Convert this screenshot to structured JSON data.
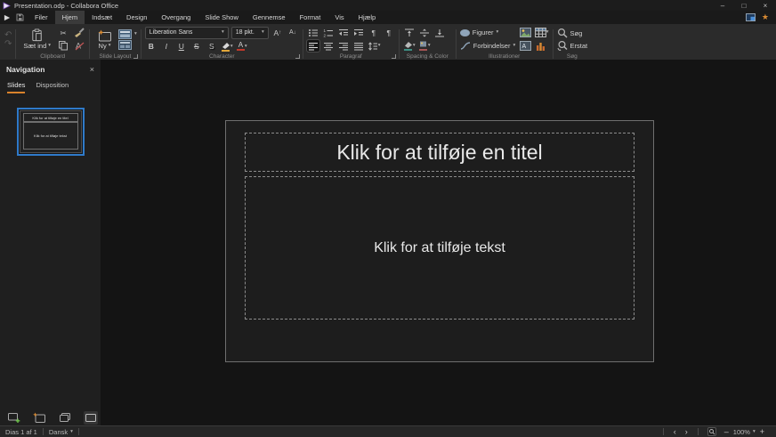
{
  "icons": {
    "dropdown": "▾",
    "minimize": "–",
    "maximize": "□",
    "close": "×",
    "undo": "↶",
    "redo": "↷",
    "cut": "✂",
    "pilcrow": "¶",
    "star": "★",
    "prev": "‹",
    "next": "›",
    "minus": "–",
    "plus": "+",
    "bold": "B",
    "italic": "I",
    "underline": "U",
    "strikethrough": "S",
    "shadow": "S",
    "font_color": "A",
    "grow_font": "A",
    "shrink_font": "A",
    "clear_format": "A",
    "up": "↑",
    "down": "↓",
    "panel_close": "×"
  },
  "titlebar": {
    "title": "Presentation.odp - Collabora Office"
  },
  "menubar": {
    "items": [
      "Filer",
      "Hjem",
      "Indsæt",
      "Design",
      "Overgang",
      "Slide Show",
      "Gennemse",
      "Format",
      "Vis",
      "Hjælp"
    ]
  },
  "toolbar": {
    "paste_label": "Sæt ind",
    "new_slide_label": "Ny",
    "font_name": "Liberation Sans",
    "font_size": "18 pkt.",
    "shapes_label": "Figurer",
    "connectors_label": "Forbindelser",
    "search_label": "Søg",
    "replace_label": "Erstat",
    "groups": {
      "clipboard": "Clipboard",
      "slide_layout": "Slide Layout",
      "character": "Character",
      "paragraph": "Paragraf",
      "spacing_color": "Spacing & Color",
      "illustrations": "Illustrationer",
      "search": "Søg"
    }
  },
  "sidebar": {
    "title": "Navigation",
    "tab_slides": "Slides",
    "tab_outline": "Disposition",
    "thumbnail": {
      "title": "Klik for at tilføje en titel",
      "body": "Klik for at tilføje tekst"
    }
  },
  "slide": {
    "title_placeholder": "Klik for at tilføje en titel",
    "body_placeholder": "Klik for at tilføje tekst"
  },
  "statusbar": {
    "slide_info": "Dias 1 af 1",
    "language": "Dansk",
    "zoom_level": "100%"
  },
  "colors": {
    "accent_orange": "#d9822b",
    "selection_blue": "#2f7ac9"
  }
}
